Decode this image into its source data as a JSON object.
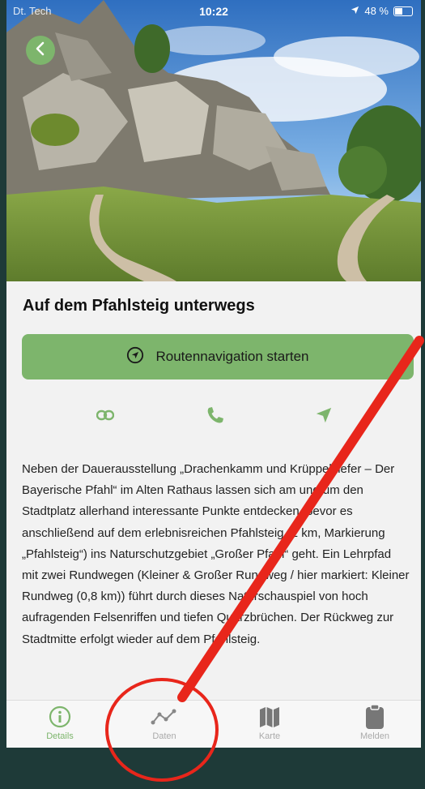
{
  "status_bar": {
    "carrier": "Dt. Tech",
    "time": "10:22",
    "battery": "48 %"
  },
  "title": "Auf dem Pfahlsteig unterwegs",
  "navigation_button": {
    "label": "Routennavigation starten"
  },
  "description": "Neben der Dauerausstellung „Drachenkamm und Krüppelkiefer – Der Bayerische Pfahl“ im Alten Rathaus lassen sich am und um den Stadtplatz allerhand interessante Punkte entdecken, bevor es anschließend auf dem erlebnisreichen Pfahlsteig (2 km, Markierung „Pfahlsteig“) ins Naturschutzgebiet „Großer Pfahl“ geht. Ein Lehrpfad mit zwei Rundwegen (Kleiner & Großer Rundweg / hier markiert: Kleiner Rundweg (0,8 km)) führt durch dieses Naturschauspiel von hoch aufragenden Felsenriffen und tiefen Quarzbrüchen. Der Rückweg zur Stadtmitte erfolgt wieder auf dem Pfahlsteig.",
  "actions": [
    {
      "icon": "link-icon"
    },
    {
      "icon": "phone-icon"
    },
    {
      "icon": "location-arrow-icon"
    }
  ],
  "tabs": [
    {
      "label": "Details",
      "icon": "info-icon",
      "active": true
    },
    {
      "label": "Daten",
      "icon": "chart-line-icon",
      "active": false
    },
    {
      "label": "Karte",
      "icon": "map-icon",
      "active": false
    },
    {
      "label": "Melden",
      "icon": "clipboard-icon",
      "active": false
    }
  ],
  "colors": {
    "accent": "#7db56c",
    "annotation": "#e8261b",
    "background": "#1e3a38"
  }
}
